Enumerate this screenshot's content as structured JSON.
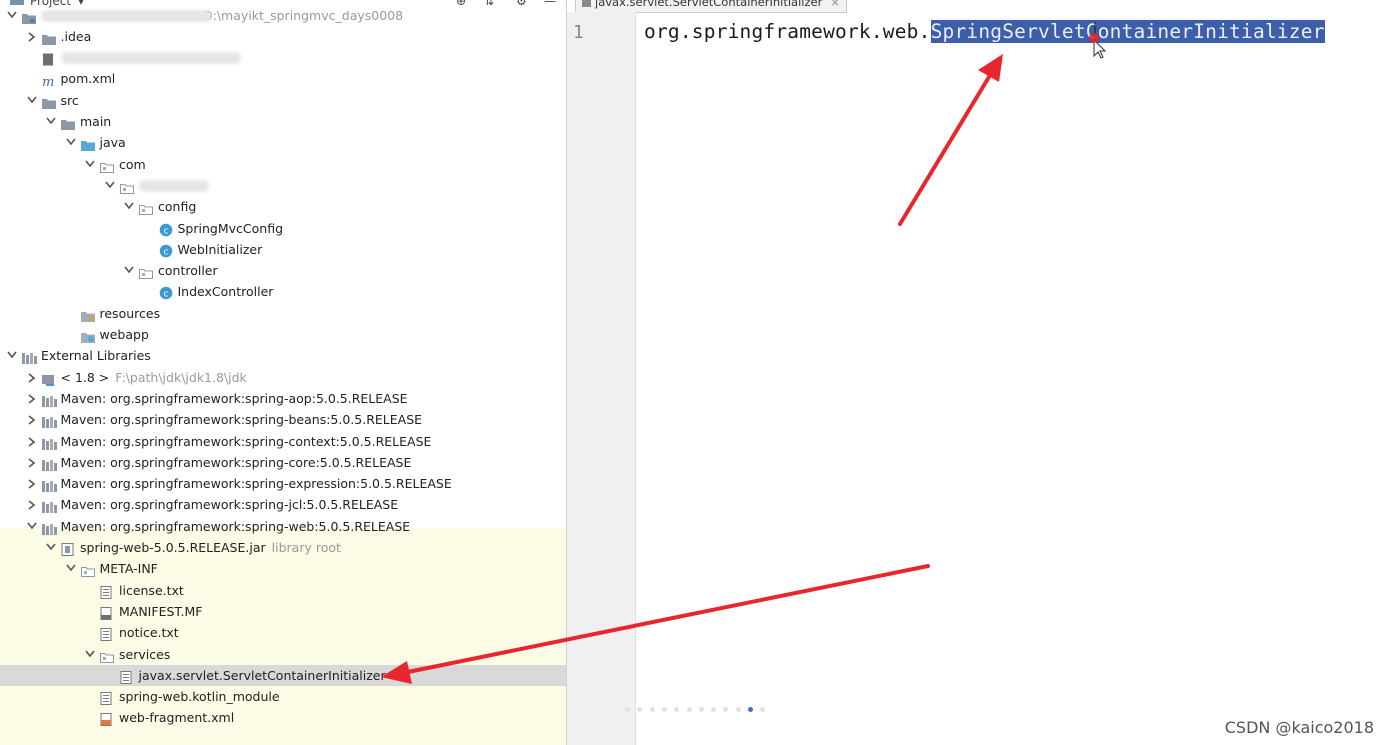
{
  "project_panel": {
    "title": "Project",
    "root_path": "D:\\mayikt_springmvc_days0008"
  },
  "tree": [
    {
      "label": "",
      "hint": "D:\\mayikt_springmvc_days0008",
      "icon": "module-folder-icon",
      "expanded": true,
      "depth": 0,
      "blurred": true,
      "bw": 170
    },
    {
      "label": ".idea",
      "icon": "folder-icon",
      "expanded": false,
      "depth": 1
    },
    {
      "label": "",
      "icon": "file-icon",
      "leaf": true,
      "depth": 1,
      "blurred": true,
      "bw": 180
    },
    {
      "label": "pom.xml",
      "icon": "maven-icon",
      "leaf": true,
      "depth": 1
    },
    {
      "label": "src",
      "icon": "folder-icon",
      "expanded": true,
      "depth": 1
    },
    {
      "label": "main",
      "icon": "folder-icon",
      "expanded": true,
      "depth": 2
    },
    {
      "label": "java",
      "icon": "source-folder-icon",
      "expanded": true,
      "depth": 3
    },
    {
      "label": "com",
      "icon": "package-icon",
      "expanded": true,
      "depth": 4
    },
    {
      "label": "",
      "icon": "package-icon",
      "expanded": true,
      "depth": 5,
      "blurred": true,
      "bw": 70
    },
    {
      "label": "config",
      "icon": "package-icon",
      "expanded": true,
      "depth": 6
    },
    {
      "label": "SpringMvcConfig",
      "icon": "class-icon",
      "leaf": true,
      "depth": 7
    },
    {
      "label": "WebInitializer",
      "icon": "class-icon",
      "leaf": true,
      "depth": 7
    },
    {
      "label": "controller",
      "icon": "package-icon",
      "expanded": true,
      "depth": 6
    },
    {
      "label": "IndexController",
      "icon": "class-icon",
      "leaf": true,
      "depth": 7
    },
    {
      "label": "resources",
      "icon": "resources-folder-icon",
      "leaf": true,
      "depth": 3
    },
    {
      "label": "webapp",
      "icon": "web-folder-icon",
      "leaf": true,
      "depth": 3
    },
    {
      "label": "External Libraries",
      "icon": "library-icon",
      "expanded": true,
      "depth": 0
    },
    {
      "label": "< 1.8 >",
      "hint": "F:\\path\\jdk\\jdk1.8\\jdk",
      "icon": "jdk-icon",
      "expanded": false,
      "depth": 1
    },
    {
      "label": "Maven: org.springframework:spring-aop:5.0.5.RELEASE",
      "icon": "library-icon",
      "expanded": false,
      "depth": 1
    },
    {
      "label": "Maven: org.springframework:spring-beans:5.0.5.RELEASE",
      "icon": "library-icon",
      "expanded": false,
      "depth": 1
    },
    {
      "label": "Maven: org.springframework:spring-context:5.0.5.RELEASE",
      "icon": "library-icon",
      "expanded": false,
      "depth": 1
    },
    {
      "label": "Maven: org.springframework:spring-core:5.0.5.RELEASE",
      "icon": "library-icon",
      "expanded": false,
      "depth": 1
    },
    {
      "label": "Maven: org.springframework:spring-expression:5.0.5.RELEASE",
      "icon": "library-icon",
      "expanded": false,
      "depth": 1
    },
    {
      "label": "Maven: org.springframework:spring-jcl:5.0.5.RELEASE",
      "icon": "library-icon",
      "expanded": false,
      "depth": 1
    },
    {
      "label": "Maven: org.springframework:spring-web:5.0.5.RELEASE",
      "icon": "library-icon",
      "expanded": true,
      "depth": 1
    },
    {
      "label": "spring-web-5.0.5.RELEASE.jar",
      "hint": "library root",
      "icon": "jar-icon",
      "expanded": true,
      "depth": 2
    },
    {
      "label": "META-INF",
      "icon": "package-icon",
      "expanded": true,
      "depth": 3
    },
    {
      "label": "license.txt",
      "icon": "text-file-icon",
      "leaf": true,
      "depth": 4
    },
    {
      "label": "MANIFEST.MF",
      "icon": "manifest-file-icon",
      "leaf": true,
      "depth": 4
    },
    {
      "label": "notice.txt",
      "icon": "text-file-icon",
      "leaf": true,
      "depth": 4
    },
    {
      "label": "services",
      "icon": "package-icon",
      "expanded": true,
      "depth": 4
    },
    {
      "label": "javax.servlet.ServletContainerInitializer",
      "icon": "text-file-icon",
      "leaf": true,
      "depth": 5,
      "selected": true
    },
    {
      "label": "spring-web.kotlin_module",
      "icon": "text-file-icon",
      "leaf": true,
      "depth": 4
    },
    {
      "label": "web-fragment.xml",
      "icon": "xml-file-icon",
      "leaf": true,
      "depth": 4
    }
  ],
  "editor": {
    "tab_label": "javax.servlet.ServletContainerInitializer",
    "tab_close": "×",
    "line_number": "1",
    "code_prefix": "org.springframework.web.",
    "code_selected": "SpringServletContainerInitializer"
  },
  "watermark": "CSDN @kaico2018",
  "colors": {
    "selection": "#3d5ea8",
    "annotation_arrow": "#e8262b",
    "library_highlight": "#fbfbe6"
  }
}
